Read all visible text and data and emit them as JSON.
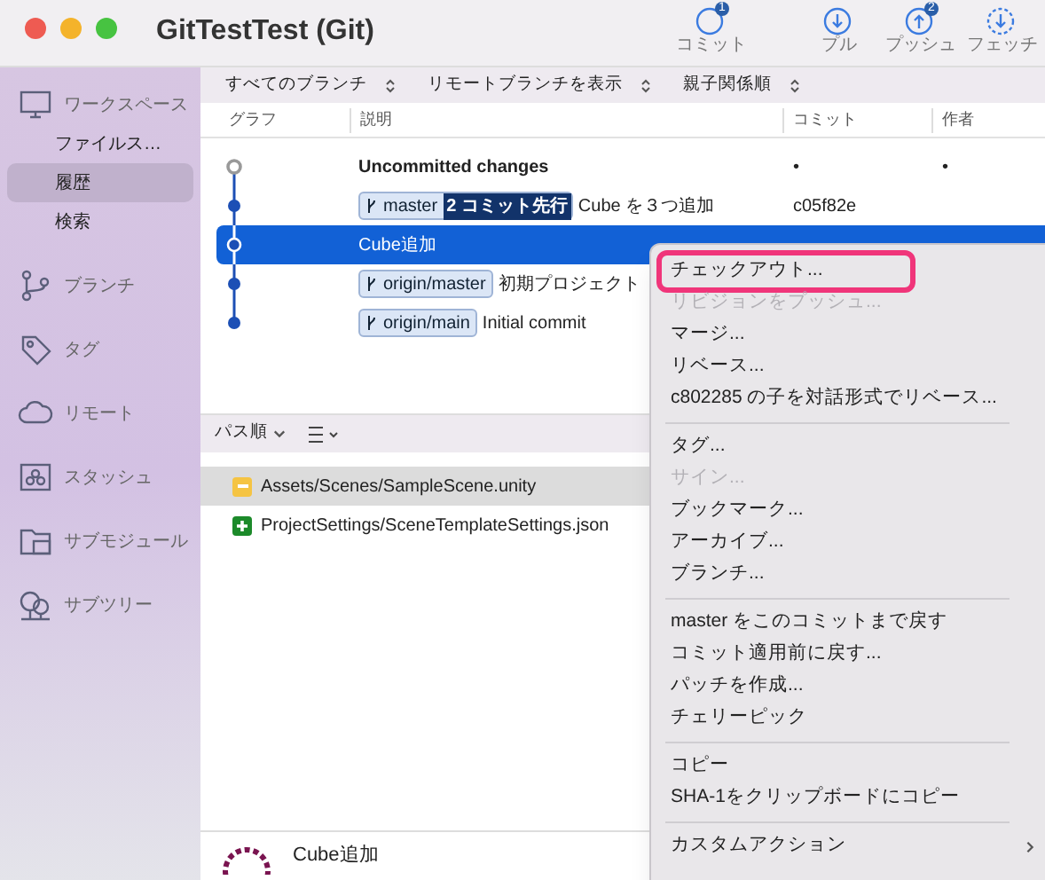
{
  "window": {
    "title": "GitTestTest (Git)"
  },
  "toolbar": [
    {
      "kind": "commit",
      "label": "コミット",
      "badge": "1"
    },
    {
      "kind": "pull",
      "label": "プル"
    },
    {
      "kind": "push",
      "label": "プッシュ",
      "badge": "2"
    },
    {
      "kind": "fetch",
      "label": "フェッチ"
    }
  ],
  "sidebar": [
    {
      "kind": "workspace",
      "label": "ワークスペース",
      "children": [
        {
          "label": "ファイルス…",
          "selected": false
        },
        {
          "label": "履歴",
          "selected": true
        },
        {
          "label": "検索",
          "selected": false
        }
      ]
    },
    {
      "kind": "branch",
      "label": "ブランチ"
    },
    {
      "kind": "tag",
      "label": "タグ"
    },
    {
      "kind": "remote",
      "label": "リモート"
    },
    {
      "kind": "stash",
      "label": "スタッシュ"
    },
    {
      "kind": "submodule",
      "label": "サブモジュール"
    },
    {
      "kind": "subtree",
      "label": "サブツリー"
    }
  ],
  "filters": [
    "すべてのブランチ",
    "リモートブランチを表示",
    "親子関係順"
  ],
  "columns": [
    "グラフ",
    "説明",
    "コミット",
    "作者"
  ],
  "rows": [
    {
      "kind": "uncommitted",
      "message": "Uncommitted changes",
      "bold": true,
      "commit": "•",
      "author": "•",
      "selected": false
    },
    {
      "kind": "commit",
      "refs": [
        {
          "name": "master",
          "ahead": "2 コミット先行"
        }
      ],
      "message": "Cube を３つ追加",
      "bold": false,
      "commit": "c05f82e",
      "selected": false
    },
    {
      "kind": "commit",
      "message": "Cube追加",
      "bold": false,
      "selected": true
    },
    {
      "kind": "commit",
      "refs": [
        {
          "name": "origin/master"
        }
      ],
      "message": "初期プロジェクト",
      "bold": false,
      "selected": false
    },
    {
      "kind": "commit",
      "refs": [
        {
          "name": "origin/main"
        }
      ],
      "message": "Initial commit",
      "bold": false,
      "selected": false
    }
  ],
  "files_toolbar": {
    "sort": "パス順"
  },
  "files": [
    {
      "kind": "modified",
      "path": "Assets/Scenes/SampleScene.unity",
      "selected": true
    },
    {
      "kind": "added",
      "path": "ProjectSettings/SceneTemplateSettings.json",
      "selected": false
    }
  ],
  "detail": {
    "title": "Cube追加"
  },
  "menu": [
    {
      "kind": "item",
      "label": "チェックアウト...",
      "disabled": false,
      "highlighted": true
    },
    {
      "kind": "item",
      "label": "リビジョンをプッシュ...",
      "disabled": true,
      "highlighted": false
    },
    {
      "kind": "item",
      "label": "マージ...",
      "disabled": false,
      "highlighted": false
    },
    {
      "kind": "item",
      "label": "リベース...",
      "disabled": false,
      "highlighted": false
    },
    {
      "kind": "item",
      "label": "c802285 の子を対話形式でリベース...",
      "disabled": false,
      "highlighted": false
    },
    {
      "kind": "separator"
    },
    {
      "kind": "item",
      "label": "タグ...",
      "disabled": false,
      "highlighted": false
    },
    {
      "kind": "item",
      "label": "サイン...",
      "disabled": true,
      "highlighted": false
    },
    {
      "kind": "item",
      "label": "ブックマーク...",
      "disabled": false,
      "highlighted": false
    },
    {
      "kind": "item",
      "label": "アーカイブ...",
      "disabled": false,
      "highlighted": false
    },
    {
      "kind": "item",
      "label": "ブランチ...",
      "disabled": false,
      "highlighted": false
    },
    {
      "kind": "separator"
    },
    {
      "kind": "item",
      "label": "master をこのコミットまで戻す",
      "disabled": false,
      "highlighted": false
    },
    {
      "kind": "item",
      "label": "コミット適用前に戻す...",
      "disabled": false,
      "highlighted": false
    },
    {
      "kind": "item",
      "label": "パッチを作成...",
      "disabled": false,
      "highlighted": false
    },
    {
      "kind": "item",
      "label": "チェリーピック",
      "disabled": false,
      "highlighted": false
    },
    {
      "kind": "separator"
    },
    {
      "kind": "item",
      "label": "コピー",
      "disabled": false,
      "highlighted": false
    },
    {
      "kind": "item",
      "label": "SHA-1をクリップボードにコピー",
      "disabled": false,
      "highlighted": false
    },
    {
      "kind": "separator"
    },
    {
      "kind": "submenu",
      "label": "カスタムアクション",
      "disabled": false,
      "highlighted": false
    }
  ]
}
